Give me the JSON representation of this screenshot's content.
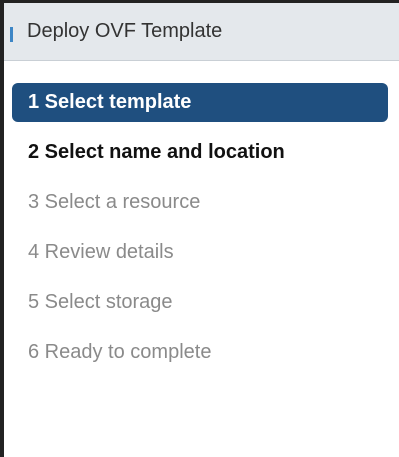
{
  "wizard": {
    "title": "Deploy OVF Template",
    "steps": [
      {
        "label": "1  Select template",
        "state": "active"
      },
      {
        "label": "2  Select name and location",
        "state": "current"
      },
      {
        "label": "3  Select a resource",
        "state": "disabled"
      },
      {
        "label": "4  Review details",
        "state": "disabled"
      },
      {
        "label": "5  Select storage",
        "state": "disabled"
      },
      {
        "label": "6  Ready to complete",
        "state": "disabled"
      }
    ]
  },
  "colors": {
    "active_step_background": "#1f4f7f",
    "header_background": "#e4e8ec",
    "accent": "#3d86c6",
    "disabled_text": "#8a8a8a"
  }
}
